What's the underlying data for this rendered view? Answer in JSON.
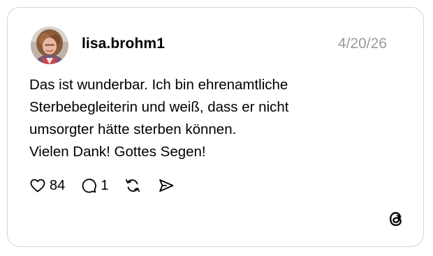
{
  "post": {
    "author": {
      "username": "lisa.brohm1"
    },
    "date": "4/20/26",
    "text_lines": [
      "Das ist wunderbar. Ich bin ehrenamtliche",
      "Sterbebegleiterin und weiß, dass er nicht",
      "umsorgter hätte sterben können.",
      "Vielen Dank! Gottes Segen!"
    ],
    "actions": {
      "like": {
        "icon": "heart-icon",
        "count": "84"
      },
      "reply": {
        "icon": "comment-icon",
        "count": "1"
      },
      "repost": {
        "icon": "repost-icon"
      },
      "share": {
        "icon": "send-icon"
      }
    }
  },
  "brand": {
    "logo_icon": "threads-logo-icon"
  },
  "colors": {
    "text": "#000000",
    "date": "#9a9a9a",
    "border": "#d6d6d6",
    "background": "#ffffff"
  }
}
